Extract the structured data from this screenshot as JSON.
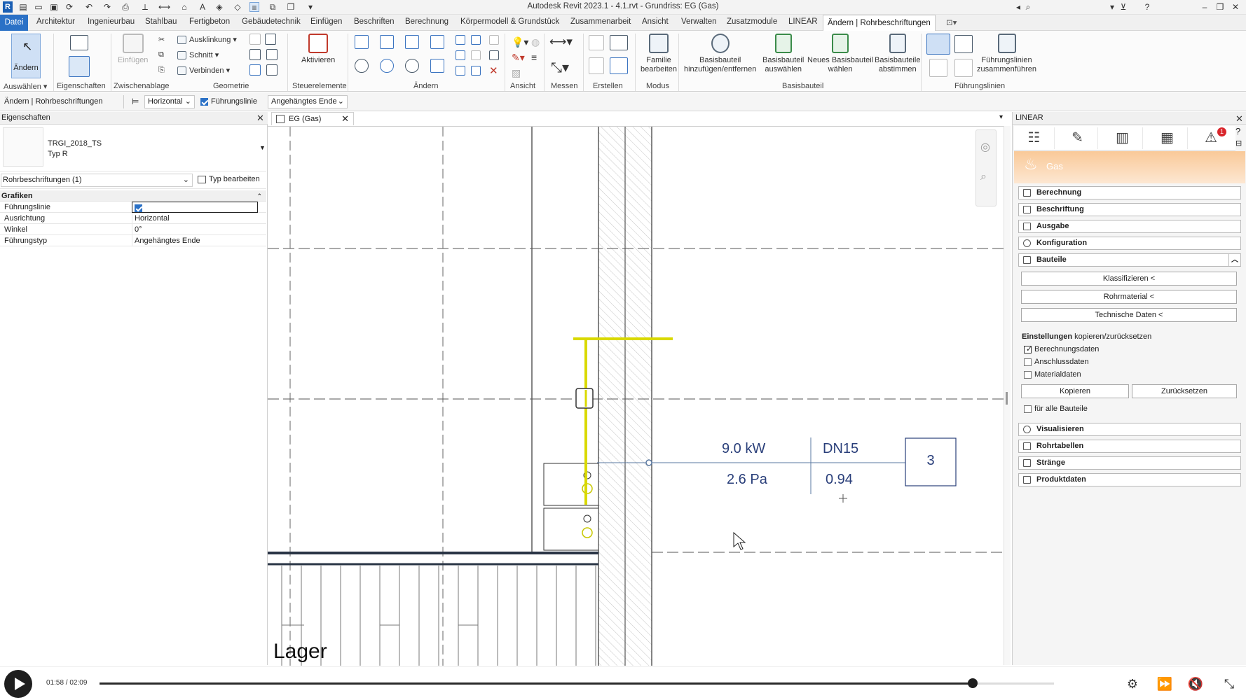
{
  "window": {
    "title": "Autodesk Revit 2023.1 - 4.1.rvt - Grundriss: EG (Gas)"
  },
  "menu": {
    "file": "Datei",
    "tabs": [
      "Architektur",
      "Ingenieurbau",
      "Stahlbau",
      "Fertigbeton",
      "Gebäudetechnik",
      "Einfügen",
      "Beschriften",
      "Berechnung",
      "Körpermodell & Grundstück",
      "Zusammenarbeit",
      "Ansicht",
      "Verwalten",
      "Zusatzmodule",
      "LINEAR"
    ],
    "active_tab": "Ändern | Rohrbeschriftungen"
  },
  "ribbon": {
    "aendern": "Ändern",
    "auswaehlen": "Auswählen",
    "eigenschaften": "Eigenschaften",
    "einfuegen": "Einfügen",
    "zwischenablage": "Zwischenablage",
    "ausklinkung": "Ausklinkung",
    "schnitt": "Schnitt",
    "verbinden": "Verbinden",
    "geometrie": "Geometrie",
    "aktivieren": "Aktivieren",
    "steuerelemente": "Steuerelemente",
    "aendern_group": "Ändern",
    "ansicht": "Ansicht",
    "messen": "Messen",
    "erstellen": "Erstellen",
    "familie_1": "Familie",
    "familie_2": "bearbeiten",
    "modus": "Modus",
    "bb_add_1": "Basisbauteil",
    "bb_add_2": "hinzufügen/entfernen",
    "bb_sel_1": "Basisbauteil",
    "bb_sel_2": "auswählen",
    "bb_new_1": "Neues Basisbauteil",
    "bb_new_2": "wählen",
    "bb_sync_1": "Basisbauteile",
    "bb_sync_2": "abstimmen",
    "basisbauteil": "Basisbauteil",
    "fl_merge_1": "Führungslinien",
    "fl_merge_2": "zusammenführen",
    "fuehrungslinien": "Führungslinien"
  },
  "optionsbar": {
    "context": "Ändern | Rohrbeschriftungen",
    "orientation": "Horizontal",
    "leader_label": "Führungslinie",
    "leader_checked": true,
    "leader_type": "Angehängtes Ende"
  },
  "properties": {
    "panel_title": "Eigenschaften",
    "type_name": "TRGI_2018_TS",
    "type_sub": "Typ R",
    "filter": "Rohrbeschriftungen (1)",
    "edit_type": "Typ bearbeiten",
    "group": "Grafiken",
    "rows": [
      {
        "key": "Führungslinie",
        "value": ""
      },
      {
        "key": "Ausrichtung",
        "value": "Horizontal"
      },
      {
        "key": "Winkel",
        "value": "0°"
      },
      {
        "key": "Führungstyp",
        "value": "Angehängtes Ende"
      }
    ]
  },
  "view": {
    "tab_title": "EG (Gas)",
    "room_label": "Lager",
    "tag": {
      "power": "9.0 kW",
      "dn": "DN15",
      "pressure": "2.6 Pa",
      "factor": "0.94",
      "number": "3"
    }
  },
  "linear": {
    "panel_title": "LINEAR",
    "mode": "Gas",
    "badge": "1",
    "sections": [
      "Berechnung",
      "Beschriftung",
      "Ausgabe",
      "Konfiguration",
      "Bauteile"
    ],
    "buttons": [
      "Klassifizieren  <",
      "Rohrmaterial  <",
      "Technische Daten  <"
    ],
    "settings_label_bold": "Einstellungen",
    "settings_label_rest": " kopieren/zurücksetzen",
    "checks": [
      {
        "label": "Berechnungsdaten",
        "checked": true
      },
      {
        "label": "Anschlussdaten",
        "checked": false
      },
      {
        "label": "Materialdaten",
        "checked": false
      }
    ],
    "copy": "Kopieren",
    "reset": "Zurücksetzen",
    "all_parts": "für alle Bauteile",
    "sections_bottom": [
      "Visualisieren",
      "Rohrtabellen",
      "Stränge",
      "Produktdaten"
    ]
  },
  "player": {
    "time": "01:58 / 02:09",
    "progress": 0.915
  }
}
